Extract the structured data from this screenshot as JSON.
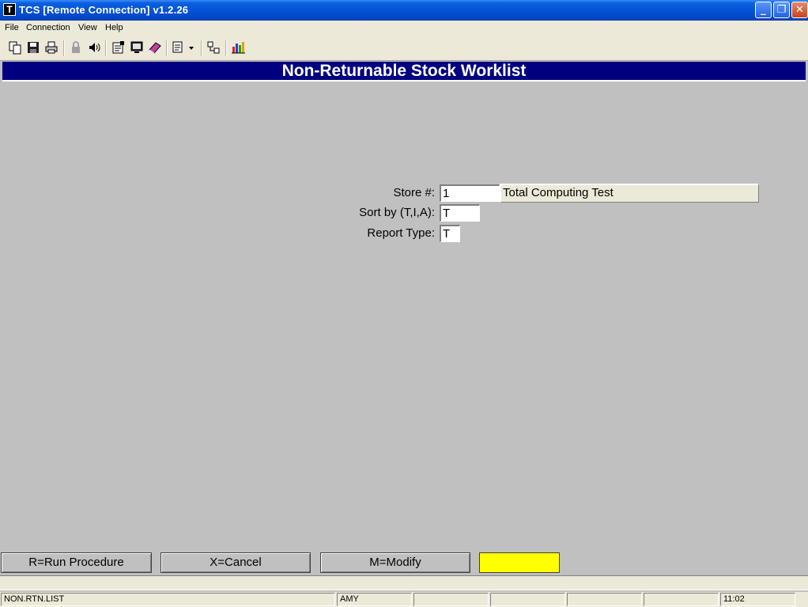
{
  "window": {
    "title": "TCS [Remote Connection]  v1.2.26",
    "app_icon_glyph": "T",
    "controls": {
      "minimize": "_",
      "restore": "❐",
      "close": "✕"
    }
  },
  "menu": [
    "File",
    "Connection",
    "View",
    "Help"
  ],
  "toolbar": {
    "icons": [
      "copy-icon",
      "save-icon",
      "print-icon",
      "lock-icon",
      "audio-icon",
      "properties-icon",
      "monitor-icon",
      "book-icon",
      "window-dropdown-icon",
      "network-icon",
      "chart-icon"
    ]
  },
  "screen": {
    "title": "Non-Returnable Stock Worklist",
    "fields": {
      "store": {
        "label": "Store #:",
        "value": "1",
        "description": "Total Computing Test"
      },
      "sort_by": {
        "label": "Sort by (T,I,A):",
        "value": "T"
      },
      "report_type": {
        "label": "Report Type:",
        "value": "T"
      }
    }
  },
  "function_keys": {
    "run": "R=Run Procedure",
    "cancel": "X=Cancel",
    "modify": "M=Modify",
    "highlight_color": "#ffff00"
  },
  "status_bar": {
    "program": "NON.RTN.LIST",
    "user": "AMY",
    "time": "11:02"
  }
}
